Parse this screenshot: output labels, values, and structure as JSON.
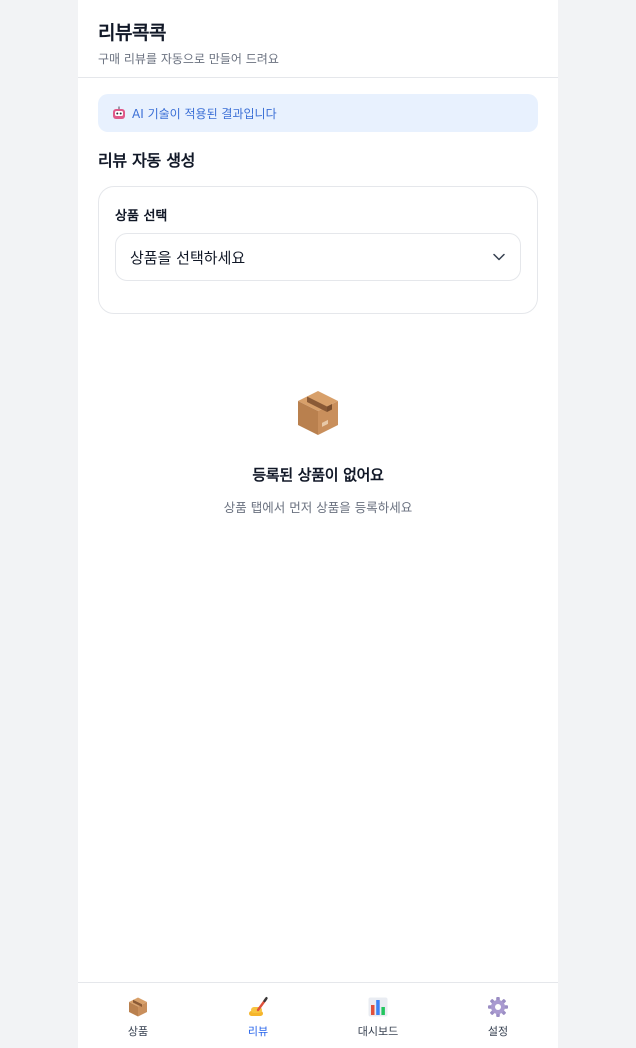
{
  "header": {
    "title": "리뷰콕콕",
    "subtitle": "구매 리뷰를 자동으로 만들어 드려요"
  },
  "ai_banner": {
    "text": "AI 기술이 적용된 결과입니다",
    "icon": "robot-icon"
  },
  "section": {
    "title": "리뷰 자동 생성"
  },
  "product_select": {
    "label": "상품 선택",
    "value": "상품을 선택하세요"
  },
  "empty_state": {
    "icon": "package-icon",
    "title": "등록된 상품이 없어요",
    "description": "상품 탭에서 먼저 상품을 등록하세요"
  },
  "tabs": [
    {
      "label": "상품",
      "icon": "package-icon",
      "active": false
    },
    {
      "label": "리뷰",
      "icon": "writing-hand-icon",
      "active": true
    },
    {
      "label": "대시보드",
      "icon": "bar-chart-icon",
      "active": false
    },
    {
      "label": "설정",
      "icon": "gear-icon",
      "active": false
    }
  ],
  "colors": {
    "accent": "#2563eb",
    "banner_bg": "#e8f1fe",
    "banner_text": "#3b6fd6"
  }
}
